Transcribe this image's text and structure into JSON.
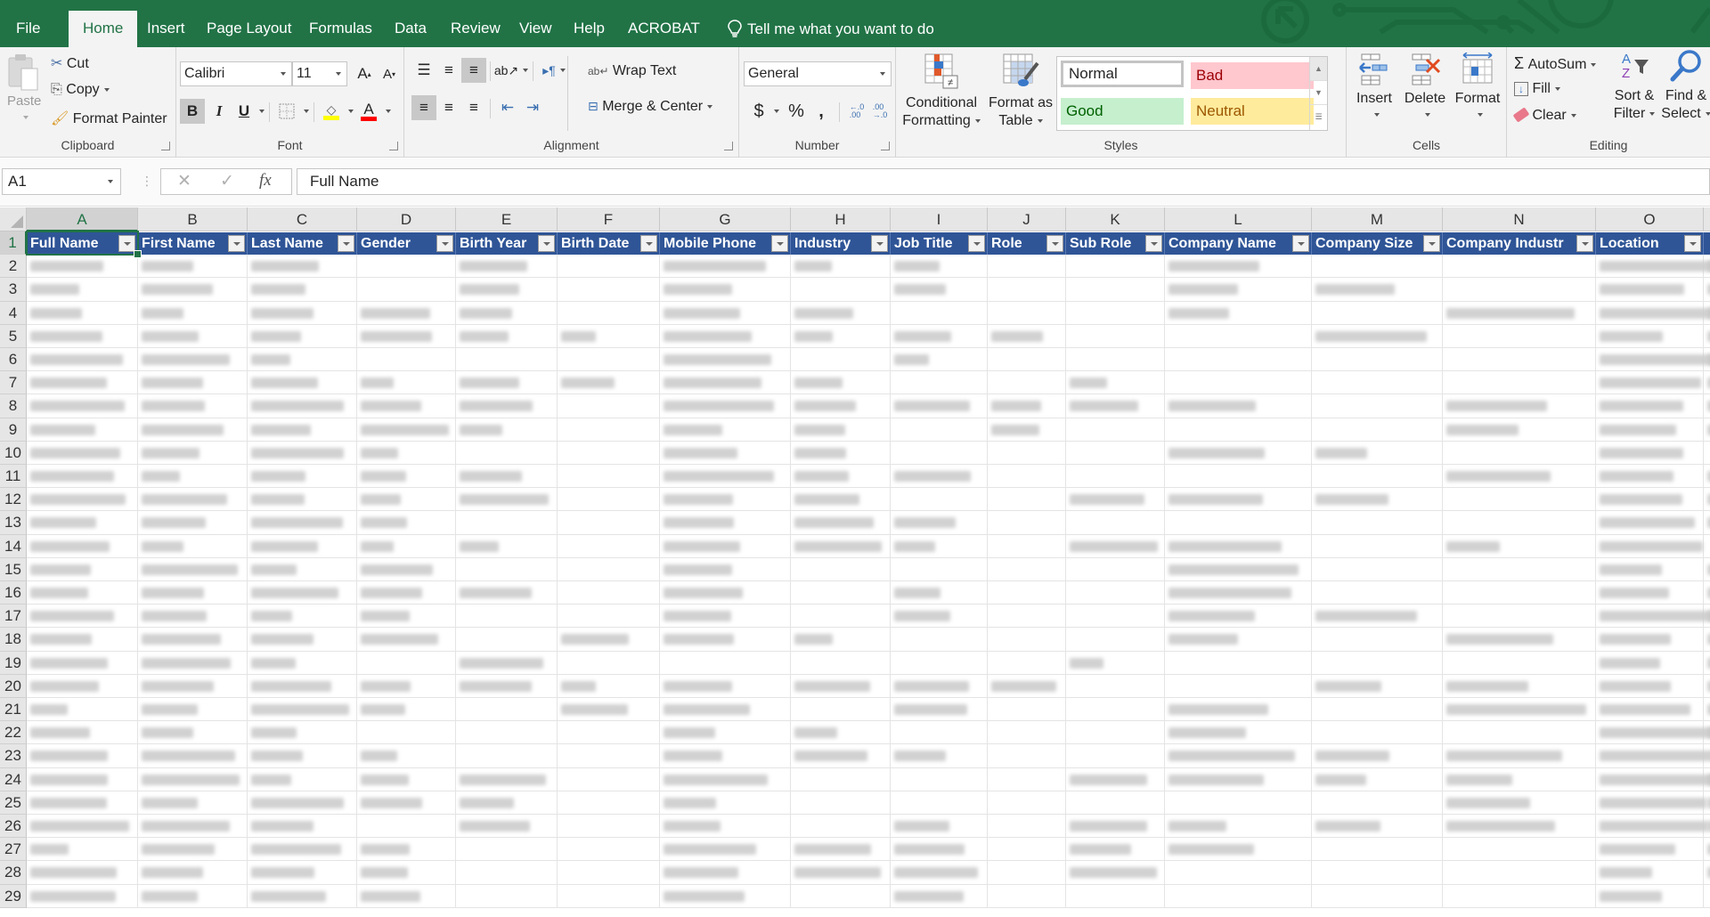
{
  "tabs": [
    {
      "label": "File",
      "active": false
    },
    {
      "label": "Home",
      "active": true
    },
    {
      "label": "Insert",
      "active": false
    },
    {
      "label": "Page Layout",
      "active": false
    },
    {
      "label": "Formulas",
      "active": false
    },
    {
      "label": "Data",
      "active": false
    },
    {
      "label": "Review",
      "active": false
    },
    {
      "label": "View",
      "active": false
    },
    {
      "label": "Help",
      "active": false
    },
    {
      "label": "ACROBAT",
      "active": false
    }
  ],
  "tell_me": "Tell me what you want to do",
  "ribbon": {
    "clipboard": {
      "label": "Clipboard",
      "paste": "Paste",
      "cut": "Cut",
      "copy": "Copy",
      "format_painter": "Format Painter"
    },
    "font": {
      "label": "Font",
      "font_name": "Calibri",
      "font_size": "11",
      "bold": "B",
      "italic": "I",
      "underline": "U",
      "grow": "A",
      "shrink": "A",
      "font_color": "A",
      "highlight_color": "#ffff00",
      "text_color": "#ff0000"
    },
    "alignment": {
      "label": "Alignment",
      "wrap_text": "Wrap Text",
      "merge_center": "Merge & Center"
    },
    "number": {
      "label": "Number",
      "format": "General",
      "currency": "$",
      "percent": "%",
      "comma": ","
    },
    "styles": {
      "label": "Styles",
      "conditional_formatting": [
        "Conditional",
        "Formatting"
      ],
      "format_as_table": [
        "Format as",
        "Table"
      ],
      "cells": [
        {
          "label": "Normal",
          "bg": "#ffffff",
          "fg": "#000000"
        },
        {
          "label": "Bad",
          "bg": "#ffc7ce",
          "fg": "#9c0006"
        },
        {
          "label": "Good",
          "bg": "#c6efce",
          "fg": "#006100"
        },
        {
          "label": "Neutral",
          "bg": "#ffeb9c",
          "fg": "#9c5700"
        }
      ]
    },
    "cells": {
      "label": "Cells",
      "insert": "Insert",
      "delete": "Delete",
      "format": "Format"
    },
    "editing": {
      "label": "Editing",
      "autosum": "AutoSum",
      "fill": "Fill",
      "clear": "Clear",
      "sort_filter": [
        "Sort &",
        "Filter"
      ],
      "find_select": [
        "Find &",
        "Select"
      ]
    }
  },
  "formula_bar": {
    "name_box": "A1",
    "formula": "Full Name",
    "fx": "fx"
  },
  "sheet": {
    "columns": [
      "A",
      "B",
      "C",
      "D",
      "E",
      "F",
      "G",
      "H",
      "I",
      "J",
      "K",
      "L",
      "M",
      "N",
      "O",
      ""
    ],
    "selected_column": "A",
    "selected_row": 1,
    "header_row": [
      "Full Name",
      "First Name",
      "Last Name",
      "Gender",
      "Birth Year",
      "Birth Date",
      "Mobile Phone",
      "Industry",
      "Job Title",
      "Role",
      "Sub Role",
      "Company Name",
      "Company Size",
      "Company Industr",
      "Location",
      ""
    ],
    "row_numbers": [
      1,
      2,
      3,
      4,
      5,
      6,
      7,
      8,
      9,
      10,
      11,
      12,
      13,
      14,
      15,
      16,
      17,
      18,
      19,
      20,
      21,
      22,
      23,
      24,
      25,
      26,
      27,
      28,
      29
    ],
    "cell_contents_note": "blurred"
  },
  "colors": {
    "excel_green": "#217346",
    "table_header": "#2f5597"
  }
}
